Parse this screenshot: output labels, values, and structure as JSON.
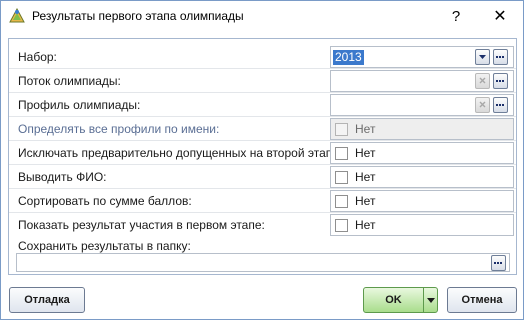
{
  "window": {
    "title": "Результаты первого этапа олимпиады",
    "help": "?",
    "close": "✕"
  },
  "form": {
    "rows": [
      {
        "label": "Набор:",
        "value": "2013"
      },
      {
        "label": "Поток олимпиады:",
        "value": ""
      },
      {
        "label": "Профиль олимпиады:",
        "value": ""
      },
      {
        "label": "Определять все профили по имени:",
        "check_label": "Нет",
        "checked": false,
        "disabled": true
      },
      {
        "label": "Исключать предварительно допущенных на второй этап:",
        "check_label": "Нет",
        "checked": false
      },
      {
        "label": "Выводить ФИО:",
        "check_label": "Нет",
        "checked": false
      },
      {
        "label": "Сортировать по сумме баллов:",
        "check_label": "Нет",
        "checked": false
      },
      {
        "label": "Показать результат участия в первом этапе:",
        "check_label": "Нет",
        "checked": false
      }
    ],
    "folder": {
      "label": "Сохранить результаты в папку:",
      "value": ""
    }
  },
  "buttons": {
    "debug": "Отладка",
    "ok": "OK",
    "cancel": "Отмена"
  },
  "icons": {
    "app": "star-pyramid-icon",
    "dropdown": "triangle-down-icon",
    "ellipsis": "ellipsis-icon",
    "clear": "x-icon"
  }
}
